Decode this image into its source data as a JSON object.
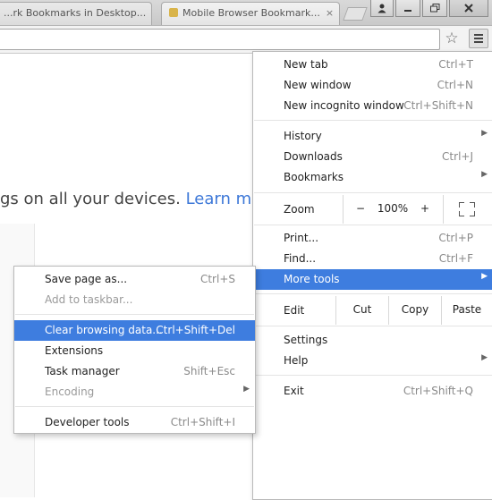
{
  "tabs": [
    {
      "title": "...rk Bookmarks in Desktop...",
      "active": false
    },
    {
      "title": "Mobile Browser Bookmark...",
      "active": true
    }
  ],
  "window_controls": [
    "user-icon",
    "minimize-icon",
    "maximize-icon",
    "close-icon"
  ],
  "page": {
    "text_before": "gs on all your devices. ",
    "link_text": "Learn more",
    "link_color": "#3d78d8"
  },
  "main_menu": {
    "new_tab": {
      "label": "New tab",
      "shortcut": "Ctrl+T"
    },
    "new_window": {
      "label": "New window",
      "shortcut": "Ctrl+N"
    },
    "new_incognito": {
      "label": "New incognito window",
      "shortcut": "Ctrl+Shift+N"
    },
    "history": {
      "label": "History"
    },
    "downloads": {
      "label": "Downloads",
      "shortcut": "Ctrl+J"
    },
    "bookmarks": {
      "label": "Bookmarks"
    },
    "zoom": {
      "label": "Zoom",
      "minus": "−",
      "value": "100%",
      "plus": "+"
    },
    "print": {
      "label": "Print...",
      "shortcut": "Ctrl+P"
    },
    "find": {
      "label": "Find...",
      "shortcut": "Ctrl+F"
    },
    "more_tools": {
      "label": "More tools",
      "highlighted": true
    },
    "edit": {
      "label": "Edit",
      "cut": "Cut",
      "copy": "Copy",
      "paste": "Paste"
    },
    "settings": {
      "label": "Settings"
    },
    "help": {
      "label": "Help"
    },
    "exit": {
      "label": "Exit",
      "shortcut": "Ctrl+Shift+Q"
    }
  },
  "sub_menu": {
    "save_page": {
      "label": "Save page as...",
      "shortcut": "Ctrl+S"
    },
    "add_taskbar": {
      "label": "Add to taskbar...",
      "disabled": true
    },
    "clear_data": {
      "label": "Clear browsing data...",
      "shortcut": "Ctrl+Shift+Del",
      "highlighted": true
    },
    "extensions": {
      "label": "Extensions"
    },
    "task_manager": {
      "label": "Task manager",
      "shortcut": "Shift+Esc"
    },
    "encoding": {
      "label": "Encoding",
      "disabled": true
    },
    "dev_tools": {
      "label": "Developer tools",
      "shortcut": "Ctrl+Shift+I"
    }
  },
  "colors": {
    "highlight": "#3e7ddf",
    "menu_border": "#b9b9b9"
  }
}
